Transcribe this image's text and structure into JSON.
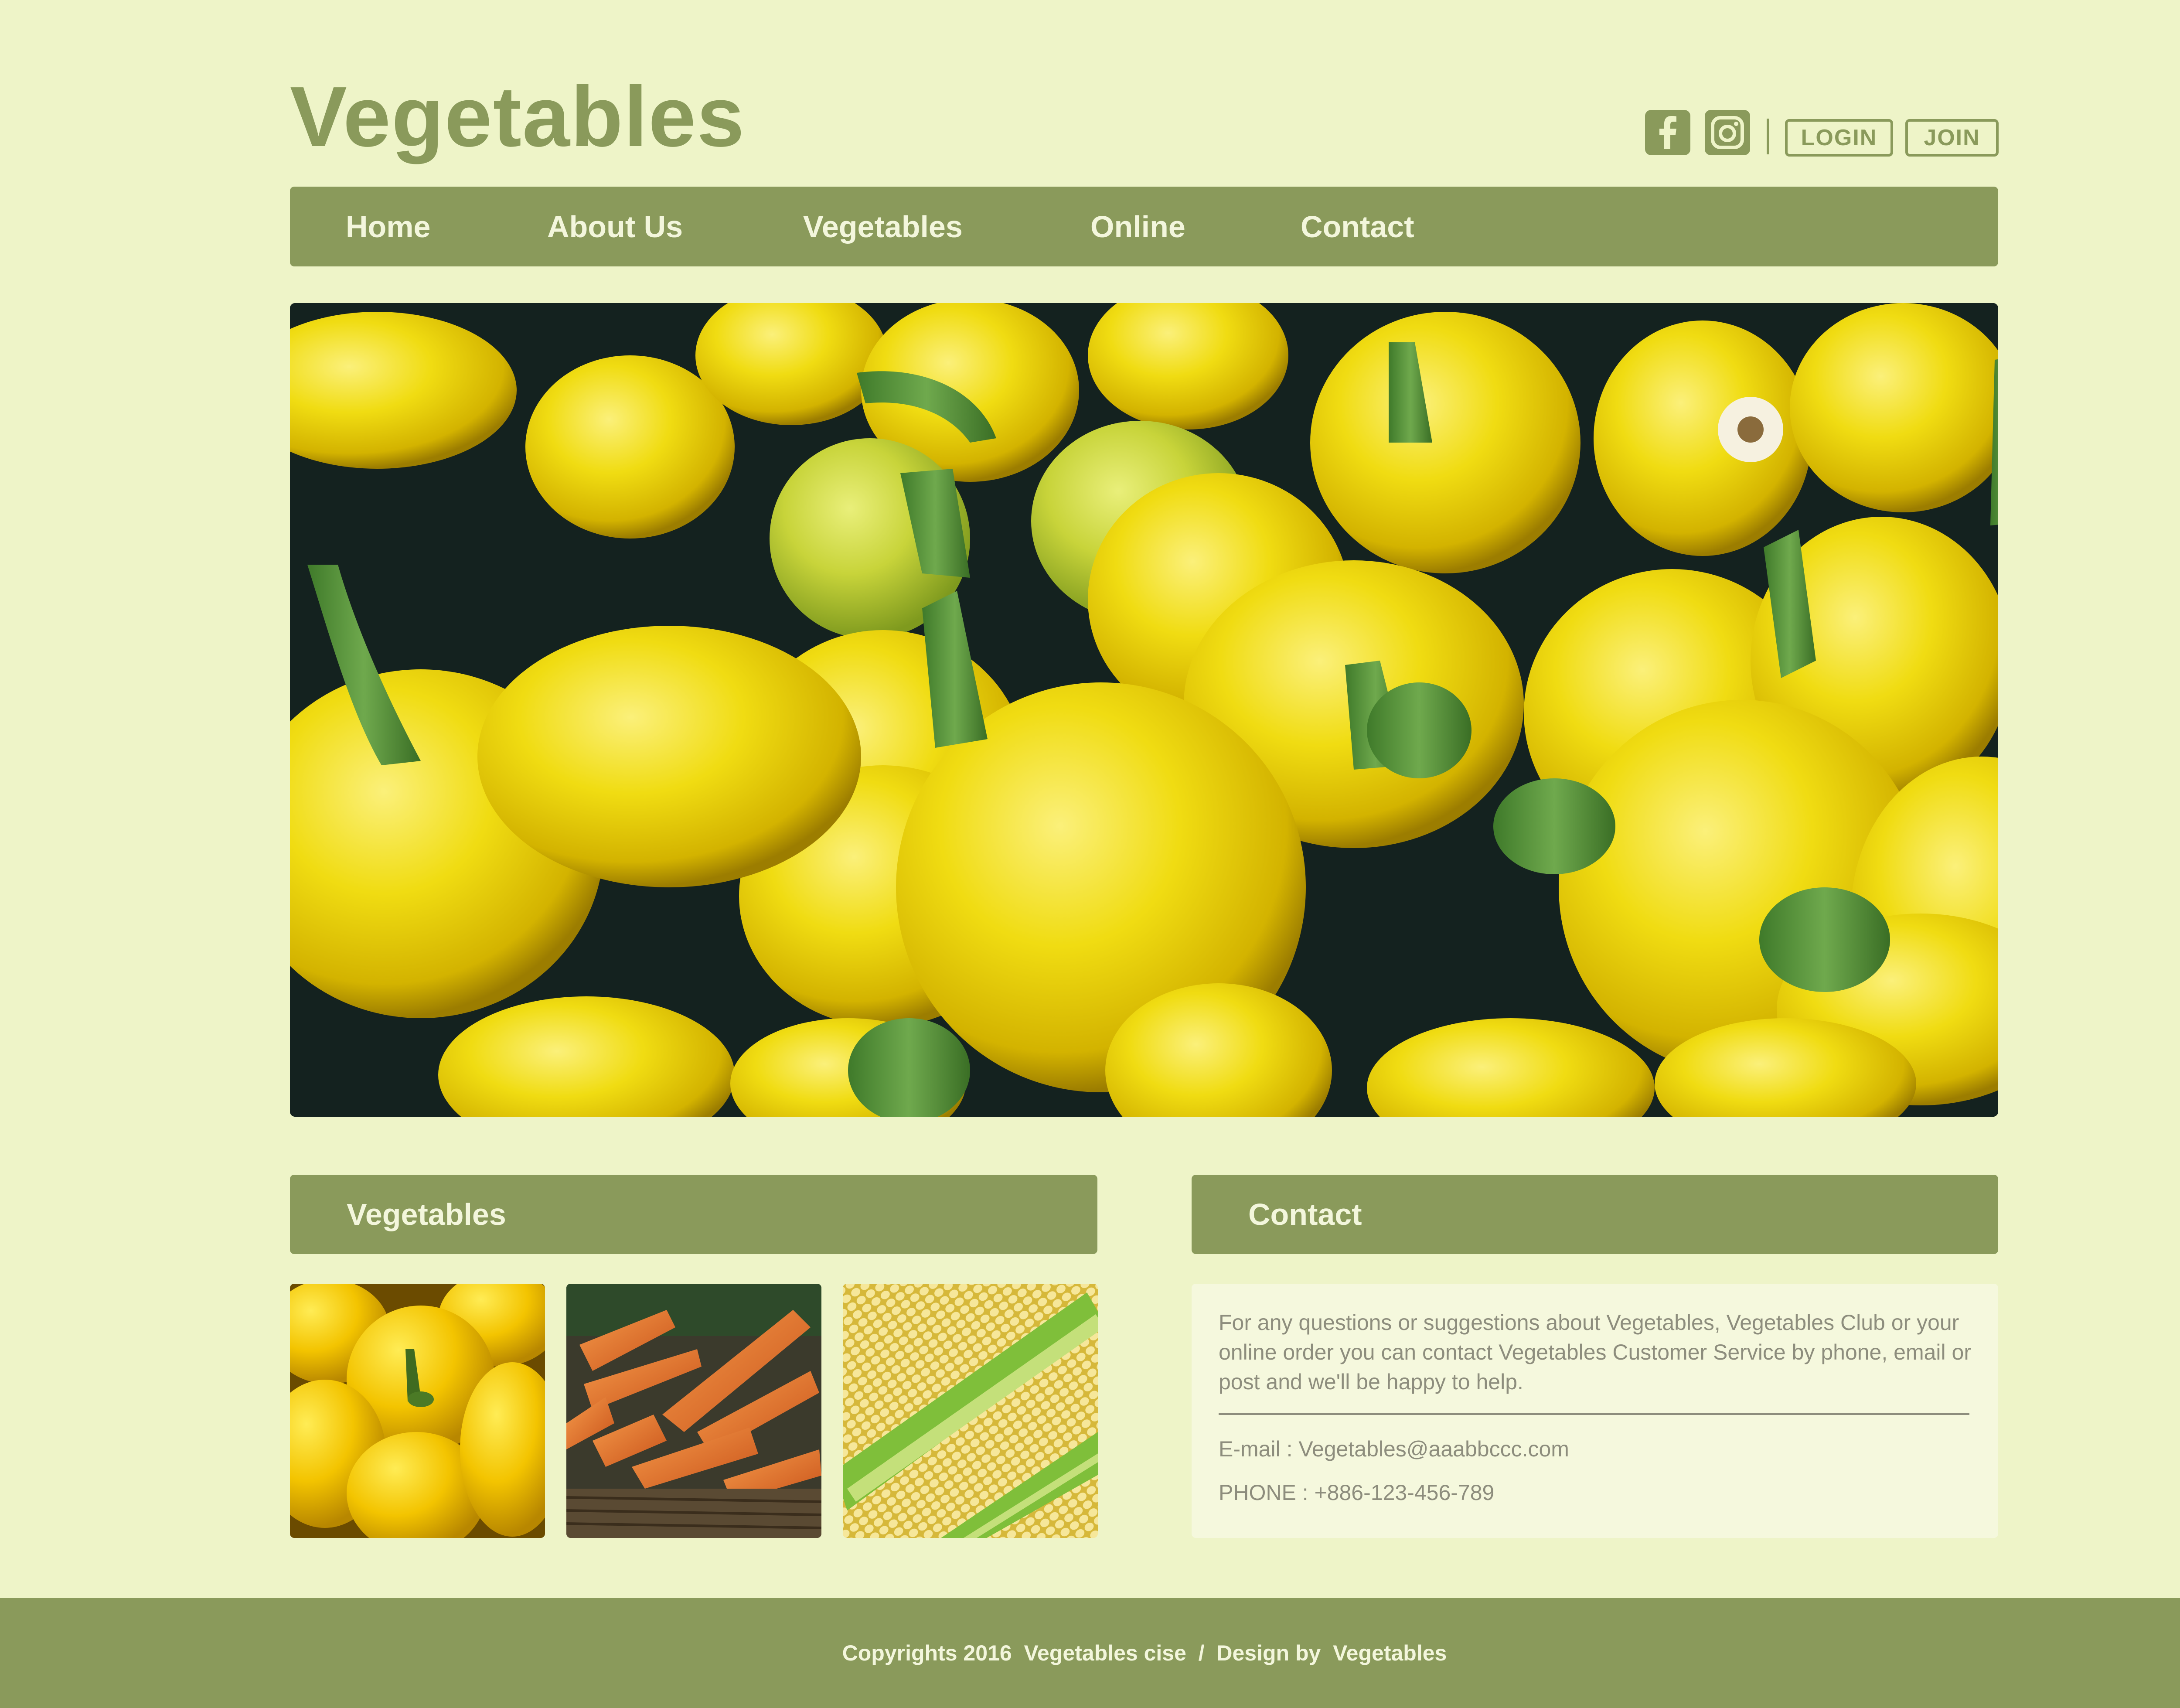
{
  "header": {
    "logo": "Vegetables",
    "login_label": "LOGIN",
    "join_label": "JOIN",
    "icons": [
      "facebook-icon",
      "instagram-icon"
    ]
  },
  "nav": {
    "items": [
      {
        "label": "Home"
      },
      {
        "label": "About Us"
      },
      {
        "label": "Vegetables"
      },
      {
        "label": "Online"
      },
      {
        "label": "Contact"
      }
    ]
  },
  "sections": {
    "vegetables_title": "Vegetables",
    "contact_title": "Contact",
    "thumbnails": [
      "yellow peppers",
      "carrots",
      "corn"
    ]
  },
  "contact": {
    "description": "For any questions or suggestions about Vegetables, Vegetables Club or your online order you can contact Vegetables Customer Service by phone, email or post and we'll be happy to help.",
    "email_line": "E-mail :  Vegetables@aaabbccc.com",
    "phone_line": "PHONE :  +886-123-456-789"
  },
  "footer": {
    "text": "Copyrights 2016  Vegetables cise  /  Design by  Vegetables"
  },
  "colors": {
    "background": "#eef4c8",
    "accent": "#8a9a5b",
    "nav_text": "#f3f6dc",
    "body_text": "#8d8d7d"
  }
}
